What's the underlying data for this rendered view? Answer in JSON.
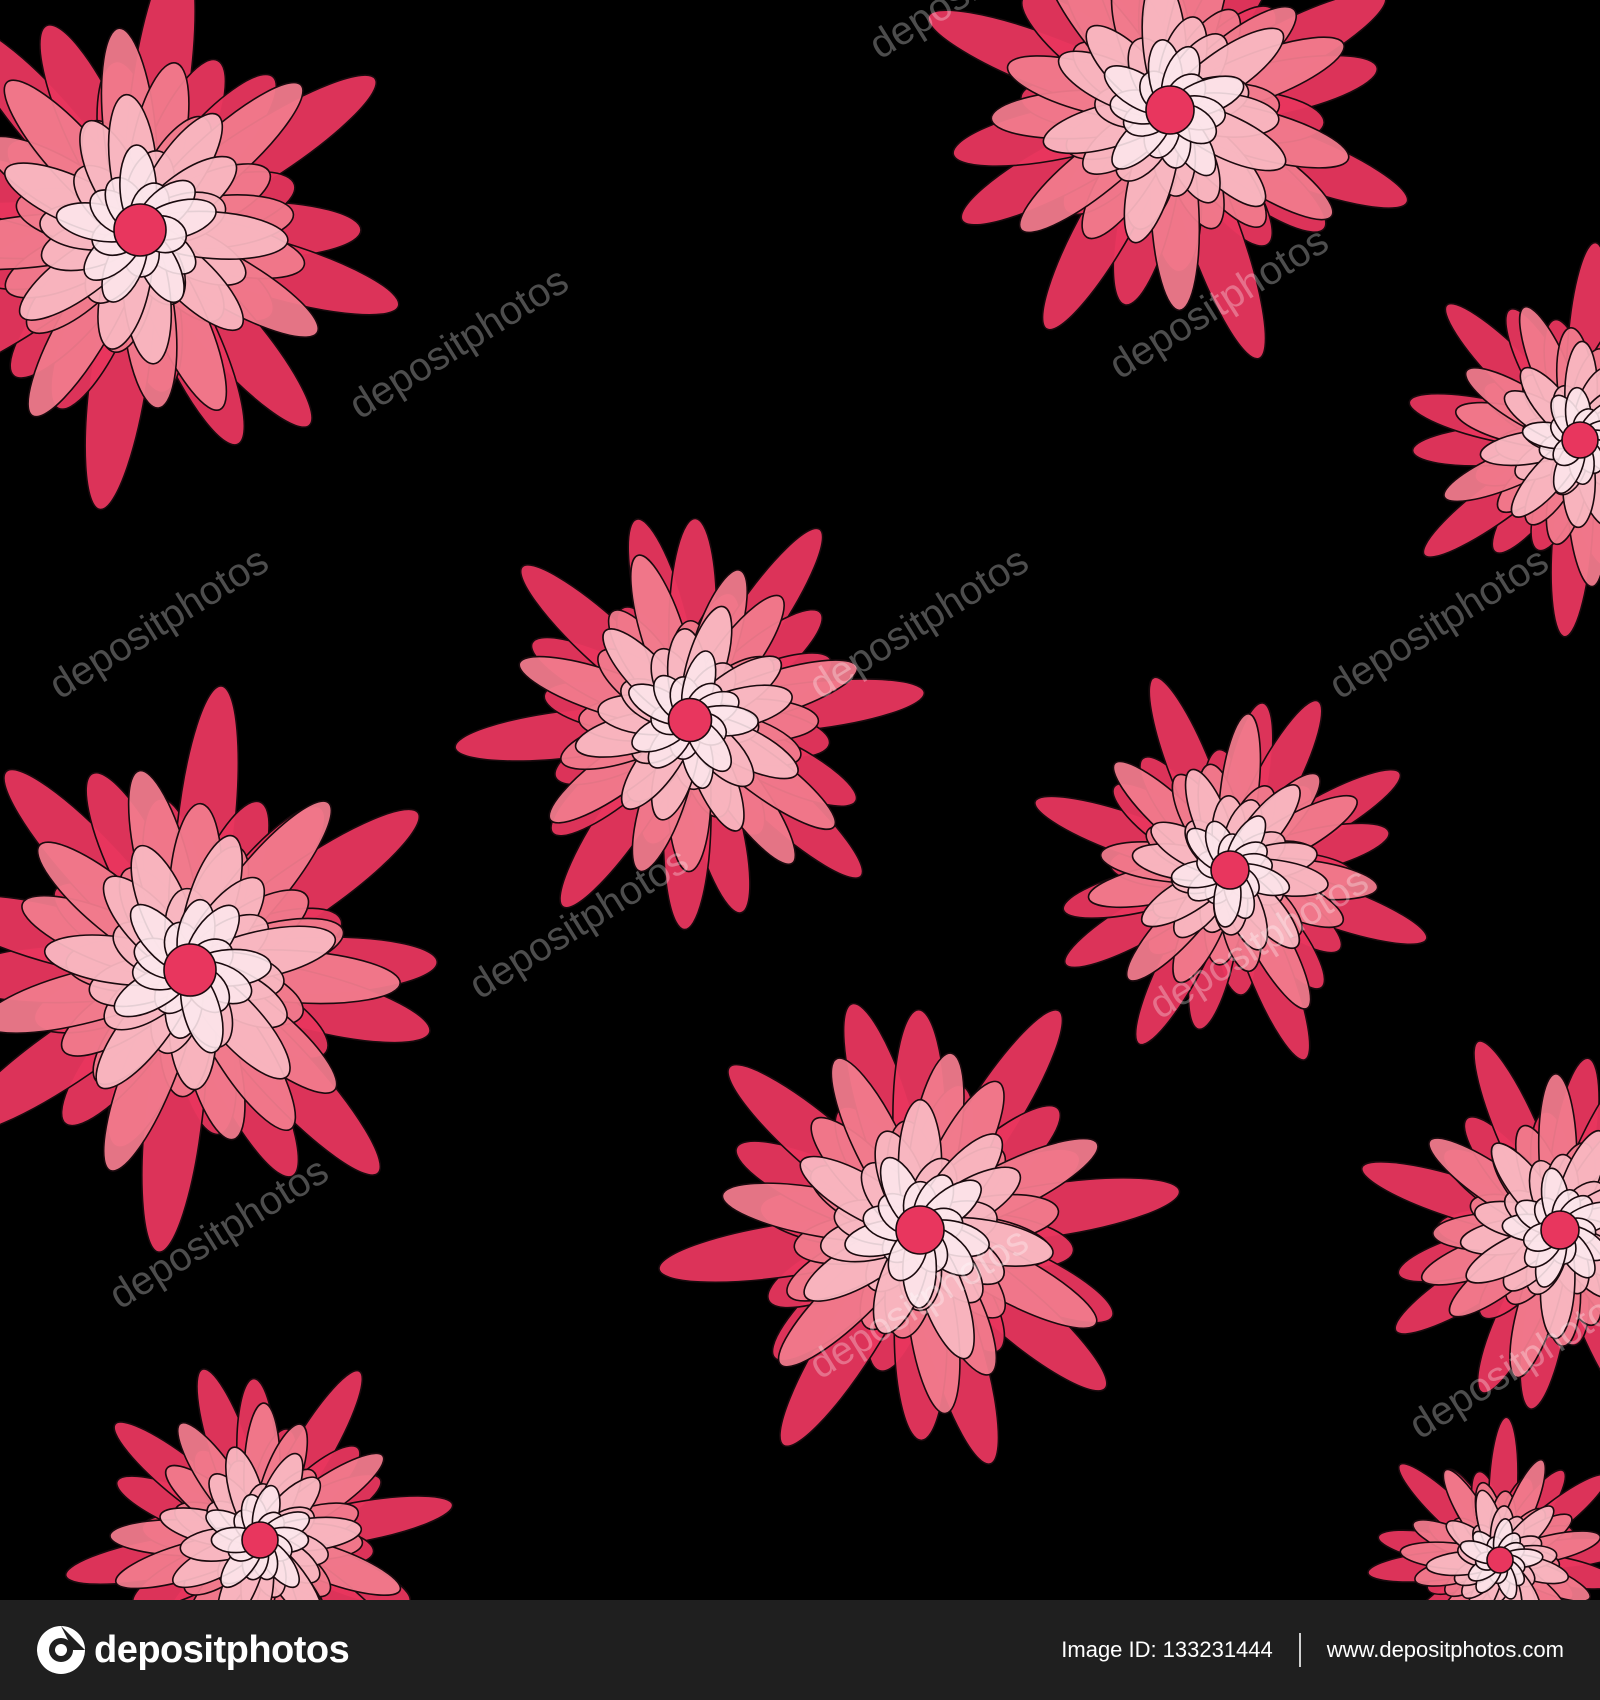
{
  "artwork": {
    "background_color": "#000000",
    "petal_colors": [
      "#e8365e",
      "#f07a8c",
      "#f8b6c0",
      "#fce4ea"
    ],
    "outline_color": "#1a0a0e",
    "watermark_text": "depositphotos"
  },
  "footer": {
    "background_color": "#1f1f1f",
    "logo_icon": "depositphotos-logo-icon",
    "logo_text": "depositphotos",
    "image_id_label": "Image ID:",
    "image_id": "133231444",
    "website": "www.depositphotos.com"
  }
}
